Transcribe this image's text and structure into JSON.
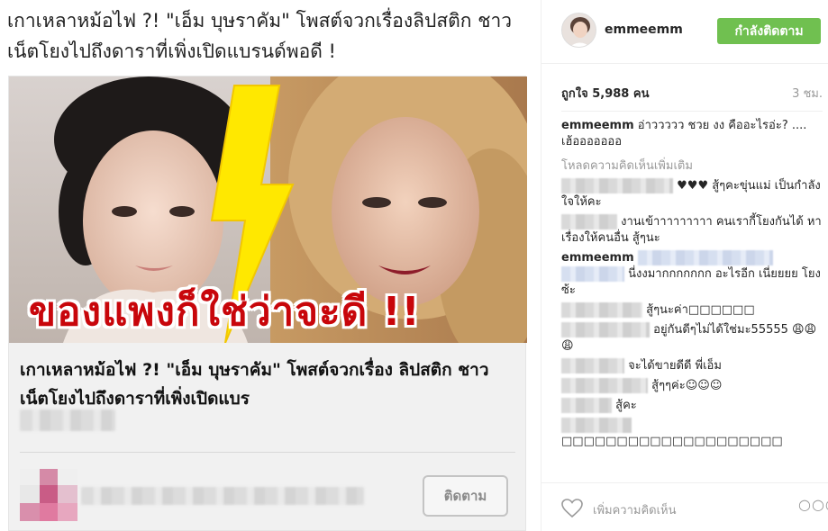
{
  "post": {
    "headline": "เกาเหลาหม้อไฟ ?! \"เอ็ม บุษราคัม\" โพสต์จวกเรื่องลิปสติก ชาวเน็ตโยงไปถึงดาราที่เพิ่งเปิดแบรนด์พอดี !",
    "card": {
      "banner_text": "ของแพงก็ใช่ว่าจะดี !!",
      "title": "เกาเหลาหม้อไฟ ?! \"เอ็ม บุษราคัม\" โพสต์จวกเรื่อง ลิปสติก ชาวเน็ตโยงไปถึงดาราที่เพิ่งเปิดแบร",
      "follow_label": "ติดตาม"
    }
  },
  "instagram": {
    "username": "emmeemm",
    "follow_button": "กำลังติดตาม",
    "likes": "ถูกใจ 5,988 คน",
    "time": "3 ชม.",
    "caption_user": "emmeemm",
    "caption_text": "อ่าววววว ชวย งง คืออะไรอ่ะ? .... เฮ้อออออออ",
    "load_more": "โหลดความคิดเห็นเพิ่มเติม",
    "comments": [
      {
        "text": "♥♥♥ สู้ๆคะขุ่นแม่ เป็นกำลังใจให้คะ"
      },
      {
        "text": "งานเข้าาาาาาาาา คนเรากี้โยงกันได้ หาเรื่องให้คนอื่น สู้ๆนะ"
      },
      {
        "user": "emmeemm",
        "text": "นี่งงมากกกกกกก อะไรอีก เนี่ยยยย โยงซ้ะ"
      },
      {
        "text": "สู้ๆนะค่า□□□□□□"
      },
      {
        "text": "อยู่กันดีๆไม่ได้ใช่มะ55555 😩😩😩"
      },
      {
        "text": "จะได้ขายดีดี พี่เอ็ม"
      },
      {
        "text": "สู้ๆๆค่ะ☺☺☺"
      },
      {
        "text": "สู้คะ"
      },
      {
        "text": "□□□□□□□□□□□□□□□□□□□□"
      }
    ],
    "add_comment_placeholder": "เพิ่มความคิดเห็น",
    "more_label": "○○○"
  },
  "icons": {
    "heart": "heart-icon",
    "more": "more-options-icon"
  },
  "colors": {
    "follow_green": "#70c050",
    "banner_red": "#c8060b",
    "lightning_yellow": "#ffe800"
  }
}
